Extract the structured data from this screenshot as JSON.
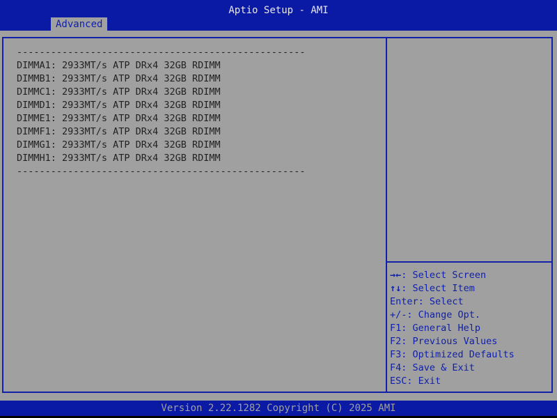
{
  "header": {
    "title": "Aptio Setup - AMI",
    "active_tab": "Advanced"
  },
  "content": {
    "separator_top": "---------------------------------------------------",
    "dimms": [
      "DIMMA1: 2933MT/s ATP DRx4 32GB RDIMM",
      "DIMMB1: 2933MT/s ATP DRx4 32GB RDIMM",
      "DIMMC1: 2933MT/s ATP DRx4 32GB RDIMM",
      "DIMMD1: 2933MT/s ATP DRx4 32GB RDIMM",
      "DIMME1: 2933MT/s ATP DRx4 32GB RDIMM",
      "DIMMF1: 2933MT/s ATP DRx4 32GB RDIMM",
      "DIMMG1: 2933MT/s ATP DRx4 32GB RDIMM",
      "DIMMH1: 2933MT/s ATP DRx4 32GB RDIMM"
    ],
    "separator_bottom": "---------------------------------------------------"
  },
  "help": {
    "items": [
      {
        "key": "→←",
        "text": ": Select Screen"
      },
      {
        "key": "↑↓",
        "text": ": Select Item"
      },
      {
        "key": "",
        "text": "Enter: Select"
      },
      {
        "key": "",
        "text": "+/-: Change Opt."
      },
      {
        "key": "",
        "text": "F1: General Help"
      },
      {
        "key": "",
        "text": "F2: Previous Values"
      },
      {
        "key": "",
        "text": "F3: Optimized Defaults"
      },
      {
        "key": "",
        "text": "F4: Save & Exit"
      },
      {
        "key": "",
        "text": "ESC: Exit"
      }
    ]
  },
  "footer": {
    "text": "Version 2.22.1282 Copyright (C) 2025 AMI"
  },
  "colors": {
    "bar_blue": "#0a1aa5",
    "panel_gray": "#a0a0a0",
    "help_blue": "#1020a8"
  }
}
